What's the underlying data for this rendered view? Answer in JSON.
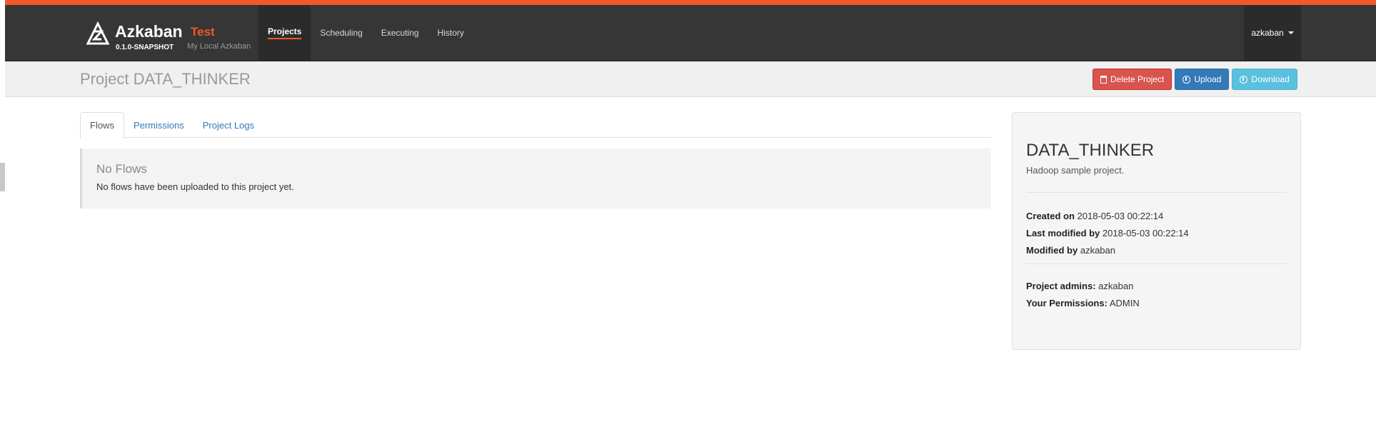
{
  "brand": {
    "name": "Azkaban",
    "environment": "Test",
    "version": "0.1.0-SNAPSHOT",
    "subtitle": "My Local Azkaban",
    "logo_icon": "azkaban-logo-icon"
  },
  "nav": {
    "items": [
      {
        "label": "Projects",
        "active": true
      },
      {
        "label": "Scheduling",
        "active": false
      },
      {
        "label": "Executing",
        "active": false
      },
      {
        "label": "History",
        "active": false
      }
    ],
    "user": "azkaban"
  },
  "header": {
    "title": "Project DATA_THINKER",
    "buttons": {
      "delete": "Delete Project",
      "upload": "Upload",
      "download": "Download"
    }
  },
  "tabs": [
    {
      "label": "Flows",
      "active": true
    },
    {
      "label": "Permissions",
      "active": false
    },
    {
      "label": "Project Logs",
      "active": false
    }
  ],
  "flows": {
    "empty_title": "No Flows",
    "empty_text": "No flows have been uploaded to this project yet."
  },
  "project_info": {
    "name": "DATA_THINKER",
    "description": "Hadoop sample project.",
    "created_label": "Created on",
    "created_value": "2018-05-03 00:22:14",
    "modified_label": "Last modified by",
    "modified_value": "2018-05-03 00:22:14",
    "modified_by_label": "Modified by",
    "modified_by_value": "azkaban",
    "admins_label": "Project admins:",
    "admins_value": "azkaban",
    "permissions_label": "Your Permissions:",
    "permissions_value": "ADMIN"
  },
  "colors": {
    "accent": "#f05a28",
    "navbar": "#363636",
    "danger": "#d9534f",
    "primary": "#337ab7",
    "info": "#5bc0de"
  }
}
